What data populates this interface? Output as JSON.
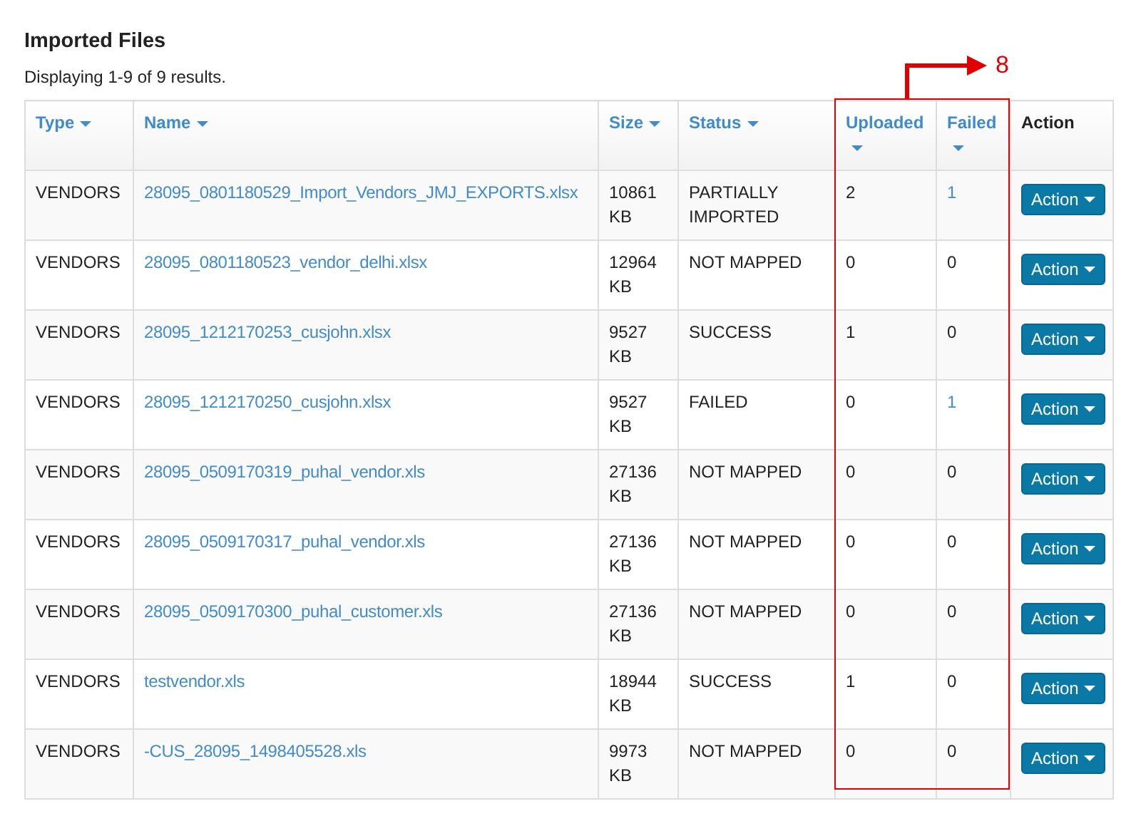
{
  "title": "Imported Files",
  "summary": "Displaying 1-9 of 9 results.",
  "columns": [
    {
      "label": "Type",
      "sortable": true
    },
    {
      "label": "Name",
      "sortable": true
    },
    {
      "label": "Size",
      "sortable": true
    },
    {
      "label": "Status",
      "sortable": true
    },
    {
      "label": "Uploaded",
      "sortable": true
    },
    {
      "label": "Failed",
      "sortable": true
    },
    {
      "label": "Action",
      "sortable": false
    }
  ],
  "rows": [
    {
      "type": "VENDORS",
      "name": "28095_0801180529_Import_Vendors_JMJ_EXPORTS.xlsx",
      "size": "10861 KB",
      "status": "PARTIALLY IMPORTED",
      "uploaded": "2",
      "failed": "1",
      "failed_link": true,
      "action": "Action"
    },
    {
      "type": "VENDORS",
      "name": "28095_0801180523_vendor_delhi.xlsx",
      "size": "12964 KB",
      "status": "NOT MAPPED",
      "uploaded": "0",
      "failed": "0",
      "failed_link": false,
      "action": "Action"
    },
    {
      "type": "VENDORS",
      "name": "28095_1212170253_cusjohn.xlsx",
      "size": "9527 KB",
      "status": "SUCCESS",
      "uploaded": "1",
      "failed": "0",
      "failed_link": false,
      "action": "Action"
    },
    {
      "type": "VENDORS",
      "name": "28095_1212170250_cusjohn.xlsx",
      "size": "9527 KB",
      "status": "FAILED",
      "uploaded": "0",
      "failed": "1",
      "failed_link": true,
      "action": "Action"
    },
    {
      "type": "VENDORS",
      "name": "28095_0509170319_puhal_vendor.xls",
      "size": "27136 KB",
      "status": "NOT MAPPED",
      "uploaded": "0",
      "failed": "0",
      "failed_link": false,
      "action": "Action"
    },
    {
      "type": "VENDORS",
      "name": "28095_0509170317_puhal_vendor.xls",
      "size": "27136 KB",
      "status": "NOT MAPPED",
      "uploaded": "0",
      "failed": "0",
      "failed_link": false,
      "action": "Action"
    },
    {
      "type": "VENDORS",
      "name": "28095_0509170300_puhal_customer.xls",
      "size": "27136 KB",
      "status": "NOT MAPPED",
      "uploaded": "0",
      "failed": "0",
      "failed_link": false,
      "action": "Action"
    },
    {
      "type": "VENDORS",
      "name": "testvendor.xls",
      "size": "18944 KB",
      "status": "SUCCESS",
      "uploaded": "1",
      "failed": "0",
      "failed_link": false,
      "action": "Action"
    },
    {
      "type": "VENDORS",
      "name": "-CUS_28095_1498405528.xls",
      "size": "9973 KB",
      "status": "NOT MAPPED",
      "uploaded": "0",
      "failed": "0",
      "failed_link": false,
      "action": "Action"
    }
  ],
  "annotation": {
    "label": "8"
  }
}
